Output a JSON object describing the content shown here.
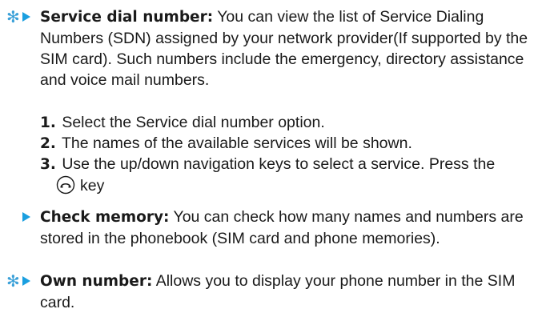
{
  "sections": [
    {
      "starred": true,
      "heading": "Service dial number:",
      "body": " You can view the list of Service Dialing Numbers (SDN) assigned by your network provider(If supported by the SIM card). Such numbers include the emergency, directory assistance and voice mail numbers."
    },
    {
      "starred": false,
      "heading": "Check memory:",
      "body": " You can check how many names and numbers are stored in the phonebook (SIM card and phone memories)."
    },
    {
      "starred": true,
      "heading": "Own number:",
      "body": " Allows you to display your phone number in the SIM card."
    }
  ],
  "steps": [
    {
      "number": "1.",
      "text": " Select the Service dial number option."
    },
    {
      "number": "2.",
      "text": " The names of the available services will be shown."
    },
    {
      "number": "3.",
      "text": " Use the up/down navigation keys to select a service. Press the",
      "key_icon": "send-call-key-icon",
      "after_key": "key"
    }
  ],
  "colors": {
    "accent": "#1a9fe0",
    "star": "#3aa0d8",
    "text": "#1a1a1a"
  },
  "icons": {
    "bullet": "triangle-bullet-icon",
    "star": "asterisk-icon"
  }
}
